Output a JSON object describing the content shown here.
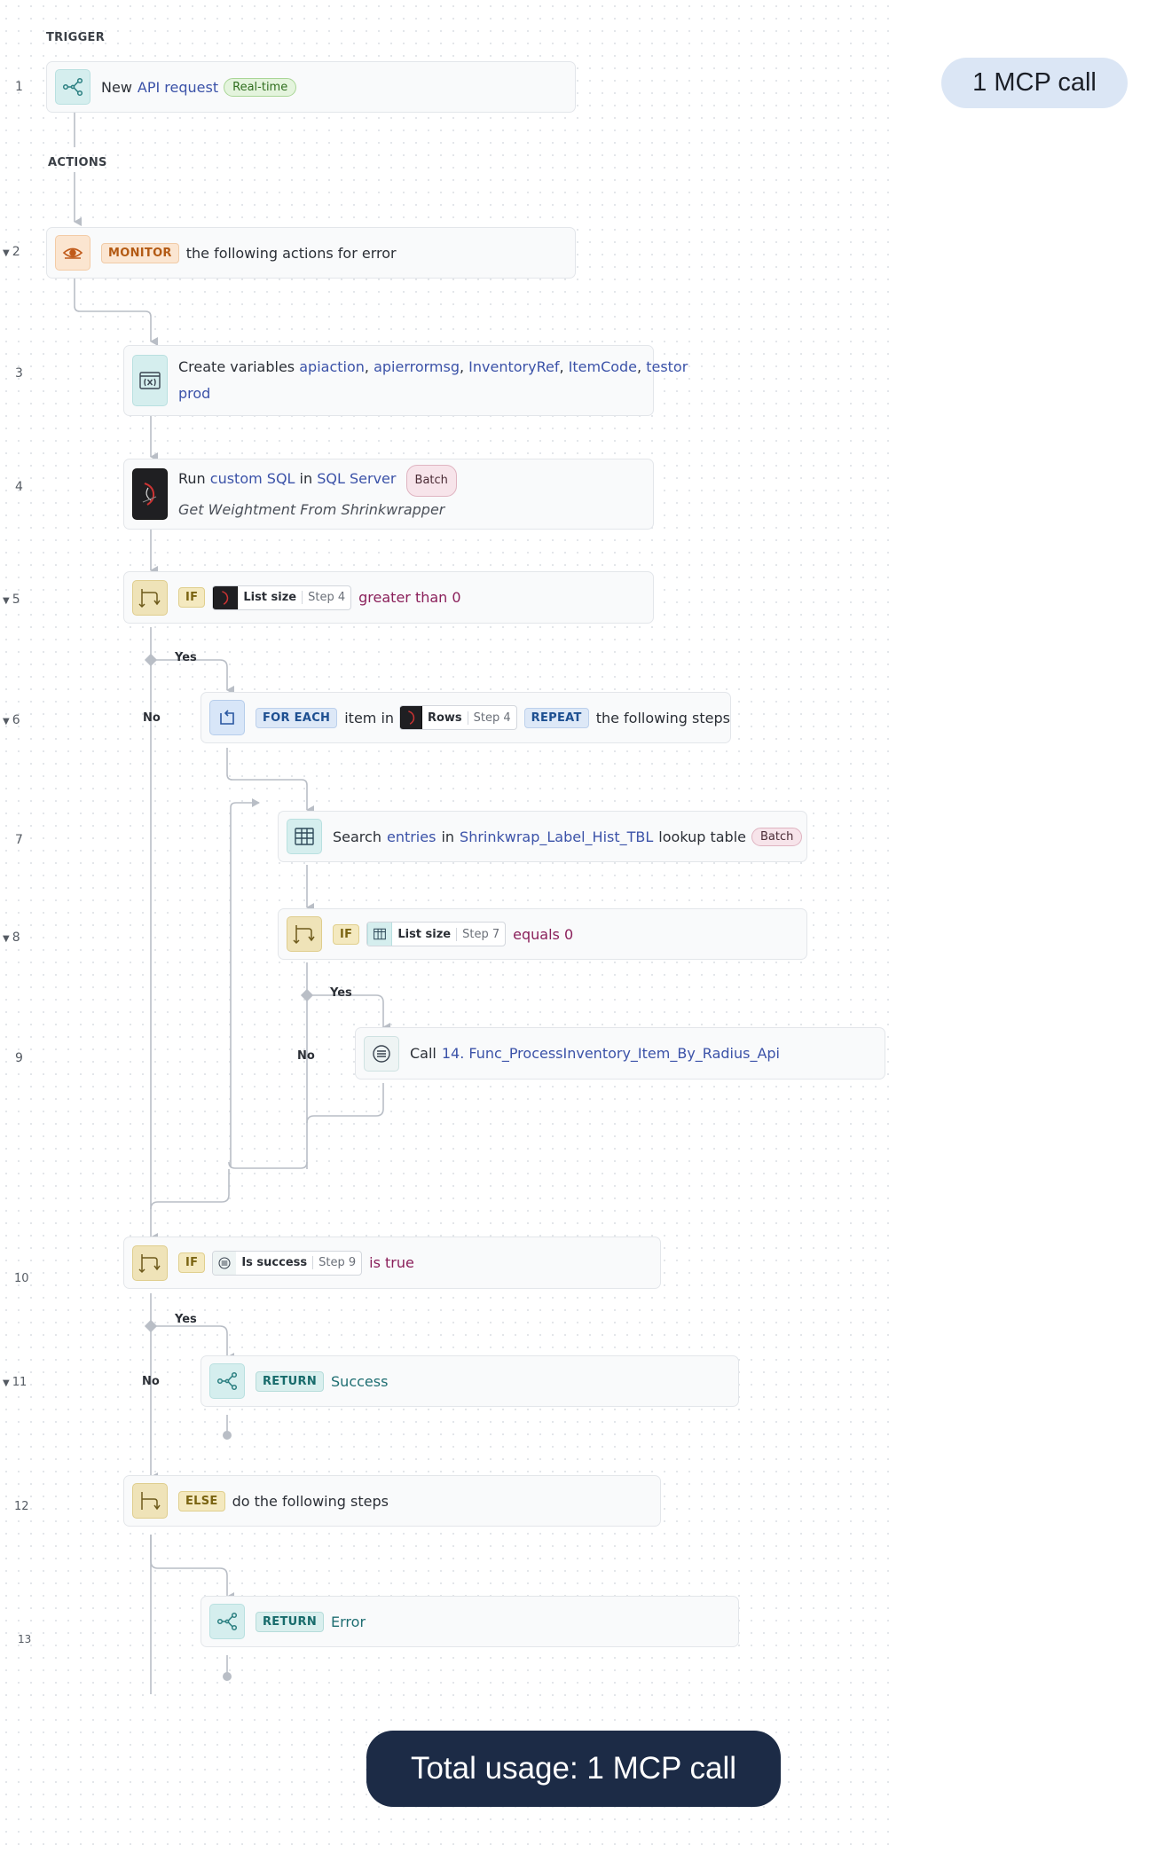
{
  "sections": {
    "trigger": "TRIGGER",
    "actions": "ACTIONS"
  },
  "steps": {
    "s1": {
      "num": "1",
      "text": "New",
      "link": "API request",
      "pill": "Real-time"
    },
    "s2": {
      "num": "2",
      "keyword": "MONITOR",
      "text": "the following actions for error"
    },
    "s3": {
      "num": "3",
      "text": "Create variables",
      "vars": [
        "apiaction",
        "apierrormsg",
        "InventoryRef",
        "ItemCode",
        "testor",
        "prod"
      ]
    },
    "s4": {
      "num": "4",
      "t1": "Run",
      "link1": "custom SQL",
      "t2": "in",
      "link2": "SQL Server",
      "pill": "Batch",
      "subtitle": "Get Weightment From Shrinkwrapper"
    },
    "s5": {
      "num": "5",
      "keyword": "IF",
      "chip_label": "List size",
      "chip_step": "Step 4",
      "cond": "greater than 0"
    },
    "s6": {
      "num": "6",
      "keyword": "FOR EACH",
      "text1": "item in",
      "chip_label": "Rows",
      "chip_step": "Step 4",
      "keyword2": "REPEAT",
      "text2": "the following steps"
    },
    "s7": {
      "num": "7",
      "t1": "Search",
      "link1": "entries",
      "t2": "in",
      "link2": "Shrinkwrap_Label_Hist_TBL",
      "t3": "lookup table",
      "pill": "Batch"
    },
    "s8": {
      "num": "8",
      "keyword": "IF",
      "chip_label": "List size",
      "chip_step": "Step 7",
      "cond": "equals 0"
    },
    "s9": {
      "num": "9",
      "t1": "Call",
      "link": "14. Func_ProcessInventory_Item_By_Radius_Api"
    },
    "s10": {
      "num": "10",
      "keyword": "IF",
      "chip_label": "Is success",
      "chip_step": "Step 9",
      "cond": "is true"
    },
    "s11": {
      "num": "11",
      "keyword": "RETURN",
      "value": "Success"
    },
    "s12": {
      "num": "12",
      "keyword": "ELSE",
      "text": "do the following steps"
    },
    "s13": {
      "num": "13",
      "keyword": "RETURN",
      "value": "Error"
    }
  },
  "branches": {
    "yes": "Yes",
    "no": "No"
  },
  "badges": {
    "top": "1 MCP call",
    "total": "Total usage: 1 MCP call"
  },
  "colors": {
    "line": "#b9bec6",
    "link": "#3b52a8",
    "condition": "#8a1f5a",
    "total_badge": "#1c2b46",
    "top_badge": "#dbe6f5"
  },
  "icons": {
    "s1": "api-branch-icon",
    "s2": "eye-icon",
    "s3": "variables-icon",
    "s4": "sql-server-icon",
    "s5": "if-branch-icon",
    "s6": "loop-icon",
    "s7": "table-icon",
    "s8": "if-branch-icon",
    "s9": "function-icon",
    "s10": "if-branch-icon",
    "s11": "return-icon",
    "s12": "else-branch-icon",
    "s13": "return-icon"
  }
}
